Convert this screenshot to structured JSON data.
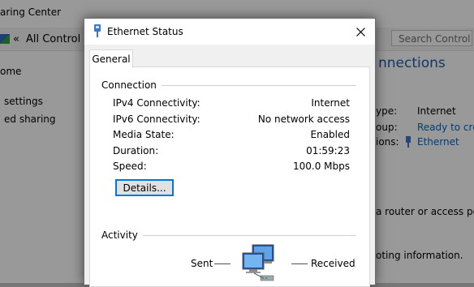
{
  "background_window": {
    "title": "aring Center",
    "breadcrumb": {
      "back": "«",
      "location": "All Control Pa"
    },
    "search_placeholder": "Search Control Pa",
    "sidebar_links": [
      "ome",
      "settings",
      "ed sharing"
    ],
    "heading": "nnections",
    "rows": [
      {
        "label": "ype:",
        "value": "Internet",
        "value_is_link": false
      },
      {
        "label": "oup:",
        "value": "Ready to crea",
        "value_is_link": true
      },
      {
        "label": "ions:",
        "value": "Ethernet",
        "value_is_link": true,
        "icon": "ethernet-icon"
      }
    ],
    "texts": [
      "a router or access po",
      "oting information."
    ]
  },
  "dialog": {
    "title": "Ethernet Status",
    "tab": "General",
    "connection": {
      "group_title": "Connection",
      "properties": [
        {
          "label": "IPv4 Connectivity:",
          "value": "Internet"
        },
        {
          "label": "IPv6 Connectivity:",
          "value": "No network access"
        },
        {
          "label": "Media State:",
          "value": "Enabled"
        },
        {
          "label": "Duration:",
          "value": "01:59:23"
        },
        {
          "label": "Speed:",
          "value": "100.0 Mbps"
        }
      ],
      "details_button": "Details..."
    },
    "activity": {
      "group_title": "Activity",
      "sent_label": "Sent",
      "received_label": "Received",
      "icon": "network-computers-icon"
    }
  },
  "colors": {
    "accent": "#0078d7",
    "link": "#0066cc",
    "heading": "#1e5aa8"
  }
}
